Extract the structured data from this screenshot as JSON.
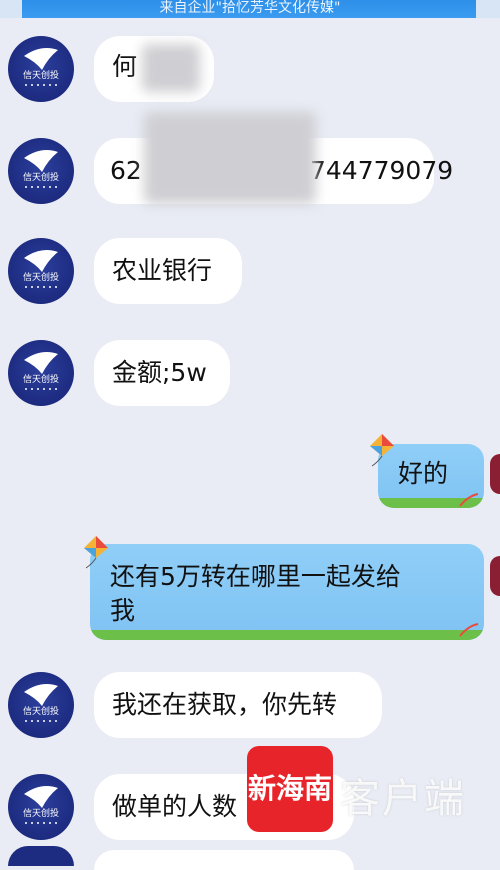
{
  "header": {
    "text": "来自企业\"拾忆芳华文化传媒\""
  },
  "messages": [
    {
      "sender": "other",
      "text": "何"
    },
    {
      "sender": "other",
      "text_start": "62",
      "text_end": "744779079"
    },
    {
      "sender": "other",
      "text": "农业银行"
    },
    {
      "sender": "other",
      "text": "金额;5w"
    },
    {
      "sender": "self",
      "text": "好的"
    },
    {
      "sender": "self",
      "text_line1": "还有5万转在哪里一起发给",
      "text_line2": "我"
    },
    {
      "sender": "other",
      "text": "我还在获取，你先转"
    },
    {
      "sender": "other",
      "text": "做单的人数"
    }
  ],
  "avatar_logo": {
    "text": "信天创投",
    "color": "#1d2b80"
  },
  "watermark": {
    "logo_text": "新海南",
    "text": "客户端",
    "color": "#e8242b"
  }
}
